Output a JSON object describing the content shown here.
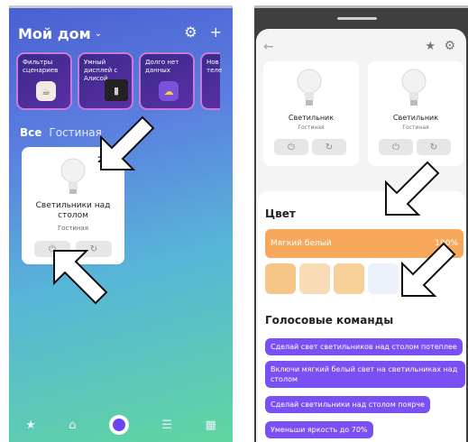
{
  "left": {
    "home_title": "Мой дом",
    "scenarios": [
      {
        "label": "Фильтры сценариев"
      },
      {
        "label": "Умный дисплей с Алисой"
      },
      {
        "label": "Долго нет данных"
      },
      {
        "label": "Нов теле"
      }
    ],
    "tabs": [
      "Все",
      "Гостиная"
    ],
    "device": {
      "name": "Светильники над столом",
      "room": "Гостиная",
      "count": "2"
    },
    "nav_icons": [
      "star-icon",
      "home-icon",
      "alice-icon",
      "remote-icon",
      "grid-icon"
    ]
  },
  "right": {
    "minis": [
      {
        "name": "Светильник",
        "room": "Гостиная"
      },
      {
        "name": "Светильник",
        "room": "Гостиная"
      }
    ],
    "color_title": "Цвет",
    "color_bar": {
      "label": "Мягкий белый",
      "value": "100%"
    },
    "swatch_colors": [
      "#f6c688",
      "#f8dcb6",
      "#f6cf99",
      "#ecf0fb"
    ],
    "voice_title": "Голосовые команды",
    "commands": [
      "Сделай свет светильников над столом потеплее",
      "Включи мягкий белый свет на светильниках над столом",
      "Сделай светильники над столом поярче",
      "Уменьши яркость до 70%"
    ]
  },
  "colors": {
    "accent": "#7b50f2",
    "warm": "#f7a85b"
  }
}
